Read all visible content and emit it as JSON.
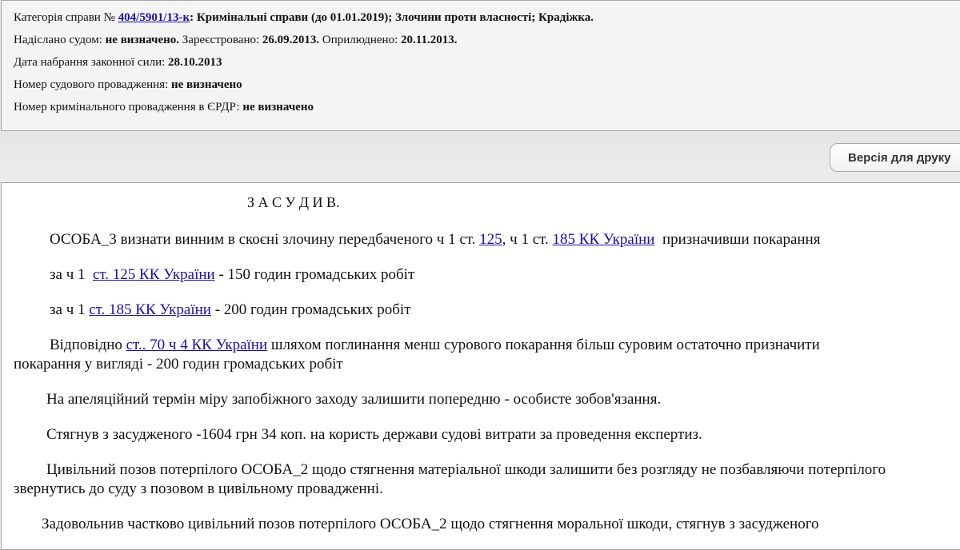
{
  "header": {
    "category_label": "Категорія справи №",
    "case_number": "404/5901/13-к",
    "category_value": ": Кримінальні справи (до 01.01.2019); Злочини проти власності; Крадіжка.",
    "sent_by_label": "Надіслано судом:",
    "sent_by_value": "не визначено.",
    "registered_label": "Зареєстровано:",
    "registered_value": "26.09.2013.",
    "published_label": "Оприлюднено:",
    "published_value": "20.11.2013.",
    "effective_label": "Дата набрання законної сили:",
    "effective_value": "28.10.2013",
    "court_proc_label": "Номер судового провадження:",
    "court_proc_value": "не визначено",
    "criminal_proc_label": "Номер кримінального провадження в ЄРДР:",
    "criminal_proc_value": "не визначено"
  },
  "toolbar": {
    "print_label": "Версія для друку"
  },
  "document": {
    "heading": "З А С У Д И В.",
    "p1_text_a": "ОСОБА_3 визнати винним в скоєні злочину передбаченого ч  1  ст.",
    "p1_link_a": "125",
    "p1_text_b": ", ч 1 ст.",
    "p1_link_b": "185 КК України",
    "p1_text_c": "призначивши покарання",
    "p2_text_a": "за ч 1",
    "p2_link": "ст. 125 КК України",
    "p2_text_b": "- 150 годин громадських робіт",
    "p3_text_a": "за ч 1",
    "p3_link": "ст. 185 КК України",
    "p3_text_b": "- 200 годин громадських робіт",
    "p4_text_a": "Відповідно",
    "p4_link": "ст.. 70 ч 4 КК України",
    "p4_text_b": "шляхом поглинання менш сурового покарання більш суровим остаточно призначити",
    "p4_line2": "покарання у вигляді - 200 годин громадських робіт",
    "p5": "На  апеляційний термін міру запобіжного заходу залишити попередню - особисте зобов'язання.",
    "p6": "Стягнув з засудженого -1604 грн 34 коп. на користь держави судові витрати за проведення експертиз.",
    "p7_line1": "Цивільний позов потерпілого ОСОБА_2 щодо стягнення матеріальної шкоди залишити без розгляду не позбавляючи потерпілого",
    "p7_line2": "звернутись до суду з позовом в цивільному провадженні.",
    "p8_line1": "Задовольнив частково цивільний позов потерпілого ОСОБА_2 щодо стягнення моральної шкоди, стягнув з засудженого"
  }
}
